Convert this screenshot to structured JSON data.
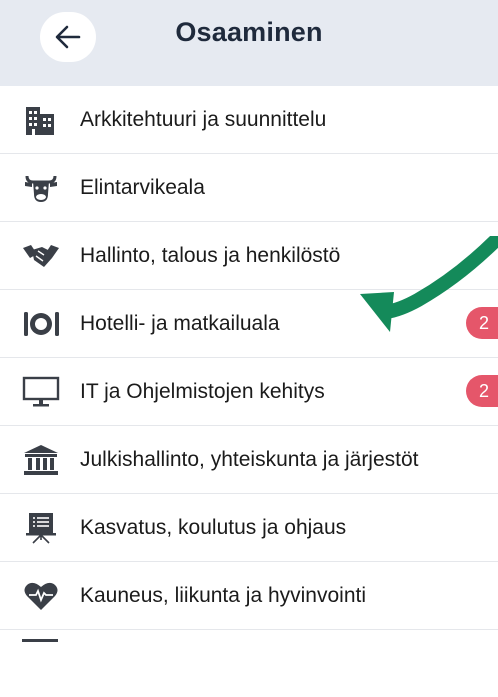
{
  "header": {
    "title": "Osaaminen",
    "back_icon": "arrow-left-icon"
  },
  "colors": {
    "header_bg": "#e6eaf1",
    "badge": "#e5566a",
    "arrow": "#148a5a",
    "icon": "#3a3f47"
  },
  "items": [
    {
      "label": "Arkkitehtuuri ja suunnittelu",
      "icon": "buildings-icon",
      "badge": ""
    },
    {
      "label": "Elintarvikeala",
      "icon": "cow-icon",
      "badge": ""
    },
    {
      "label": "Hallinto, talous ja henkilöstö",
      "icon": "handshake-icon",
      "badge": ""
    },
    {
      "label": "Hotelli- ja matkailuala",
      "icon": "plate-cutlery-icon",
      "badge": "2"
    },
    {
      "label": "IT ja Ohjelmistojen kehitys",
      "icon": "monitor-icon",
      "badge": "2"
    },
    {
      "label": "Julkishallinto, yhteiskunta ja järjestöt",
      "icon": "institution-icon",
      "badge": ""
    },
    {
      "label": "Kasvatus, koulutus ja ohjaus",
      "icon": "presentation-board-icon",
      "badge": ""
    },
    {
      "label": "Kauneus, liikunta ja hyvinvointi",
      "icon": "heartbeat-icon",
      "badge": ""
    }
  ]
}
